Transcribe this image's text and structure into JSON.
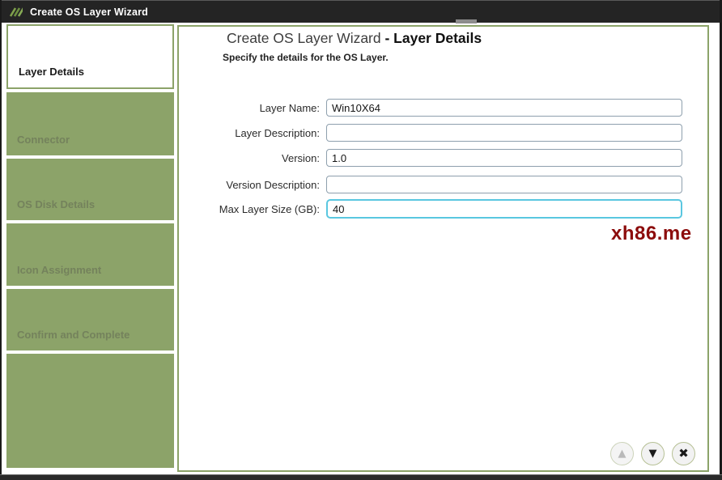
{
  "titlebar": {
    "title": "Create OS Layer Wizard",
    "logo_icon": "green-diagonal-stripes-logo"
  },
  "sidebar": {
    "steps": [
      {
        "label": "Layer Details",
        "state": "active"
      },
      {
        "label": "Connector",
        "state": "upcoming"
      },
      {
        "label": "OS Disk Details",
        "state": "upcoming"
      },
      {
        "label": "Icon Assignment",
        "state": "upcoming"
      },
      {
        "label": "Confirm and Complete",
        "state": "upcoming"
      },
      {
        "label": "",
        "state": "upcoming"
      }
    ]
  },
  "main": {
    "title_regular": "Create OS Layer Wizard ",
    "title_bold": "- Layer Details",
    "subtitle": "Specify the details for the OS Layer.",
    "fields": [
      {
        "label": "Layer Name:",
        "value": "Win10X64",
        "focused": false
      },
      {
        "label": "Layer Description:",
        "value": "",
        "focused": false
      },
      {
        "label": "Version:",
        "value": "1.0",
        "focused": false
      },
      {
        "label": "Version Description:",
        "value": "",
        "focused": false
      },
      {
        "label": "Max Layer Size (GB):",
        "value": "40",
        "focused": true
      }
    ],
    "watermark": "xh86.me",
    "buttons": {
      "up_glyph": "▲",
      "down_glyph": "▼",
      "close_glyph": "✖"
    }
  },
  "colors": {
    "green": "#8ca369",
    "titlebar_bg": "#242424",
    "focused_input_border": "#5ac7e0",
    "watermark_red": "#8c0c0c"
  }
}
